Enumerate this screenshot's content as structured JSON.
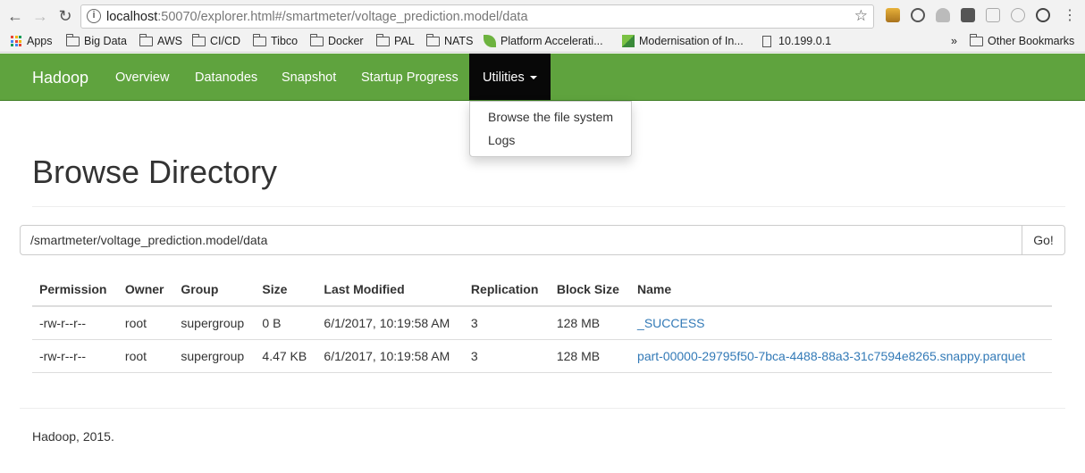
{
  "browser": {
    "url_host": "localhost",
    "url_rest": ":50070/explorer.html#/smartmeter/voltage_prediction.model/data",
    "bookmarks": [
      "Apps",
      "Big Data",
      "AWS",
      "CI/CD",
      "Tibco",
      "Docker",
      "PAL",
      "NATS",
      "Platform Accelerati...",
      "Modernisation of In...",
      "10.199.0.1",
      "Other Bookmarks"
    ],
    "overflow": "»"
  },
  "navbar": {
    "brand": "Hadoop",
    "links": [
      "Overview",
      "Datanodes",
      "Snapshot",
      "Startup Progress"
    ],
    "active": "Utilities",
    "color": "#5fa33e"
  },
  "dropdown": {
    "items": [
      "Browse the file system",
      "Logs"
    ]
  },
  "main": {
    "title": "Browse Directory",
    "path": "/smartmeter/voltage_prediction.model/data",
    "go_label": "Go!"
  },
  "table": {
    "headers": [
      "Permission",
      "Owner",
      "Group",
      "Size",
      "Last Modified",
      "Replication",
      "Block Size",
      "Name"
    ],
    "rows": [
      [
        "-rw-r--r--",
        "root",
        "supergroup",
        "0 B",
        "6/1/2017, 10:19:58 AM",
        "3",
        "128 MB",
        "_SUCCESS"
      ],
      [
        "-rw-r--r--",
        "root",
        "supergroup",
        "4.47 KB",
        "6/1/2017, 10:19:58 AM",
        "3",
        "128 MB",
        "part-00000-29795f50-7bca-4488-88a3-31c7594e8265.snappy.parquet"
      ]
    ]
  },
  "footer": "Hadoop, 2015."
}
